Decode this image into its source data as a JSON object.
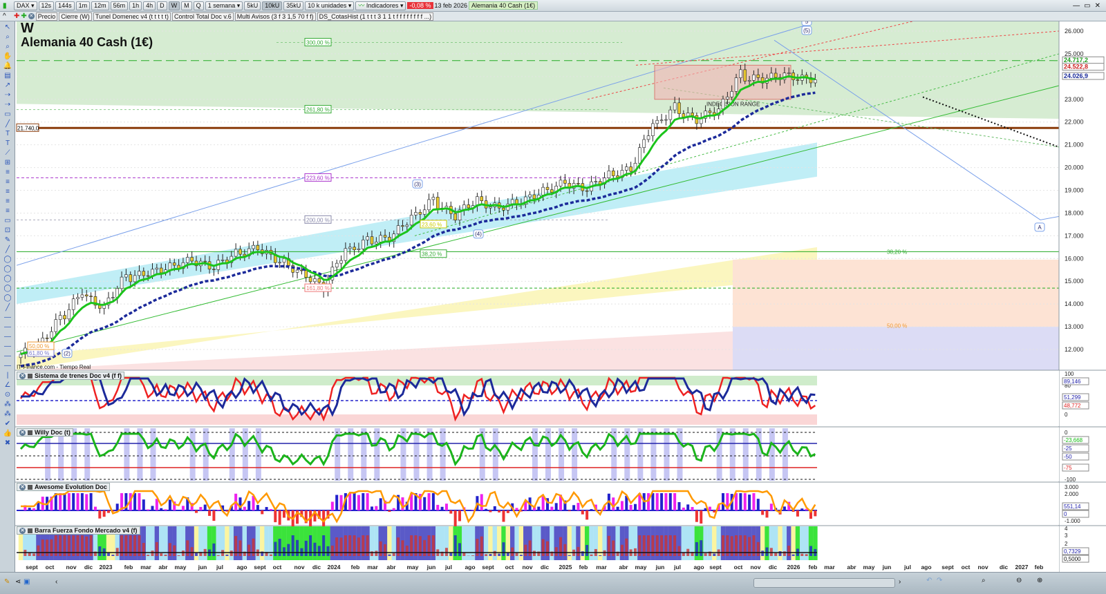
{
  "toolbar": {
    "symbol": "DAX",
    "timeframes": [
      "12s",
      "144s",
      "1m",
      "12m",
      "56m",
      "1h",
      "4h",
      "D",
      "W",
      "M",
      "Q"
    ],
    "active_timeframe": "W",
    "period": "1 semana",
    "volume_buttons": [
      "5kU",
      "10kU",
      "35kU"
    ],
    "active_volume": "10kU",
    "units": "10 k unidades",
    "indicators_label": "Indicadores",
    "change": "-0,08 %",
    "date": "13 feb 2026",
    "instrument": "Alemania 40 Cash (1€)"
  },
  "studies_bar": [
    "Precio",
    "Cierre (W)",
    "Tunel Domenec v4 (t t t t t)",
    "Control Total Doc v.6",
    "Multi Avisos (3 f 3 1,5 70 f f)",
    "DS_CotasHist (1 t t t 3 1 1 t f f f f f f f f ...)"
  ],
  "chart": {
    "period_letter": "W",
    "title": "Alemania 40 Cash (1€)",
    "source": "IT-Finance.com - Tiempo Real",
    "range_label": "INDECISION RANGE",
    "level_label": "21.740,0",
    "fib_labels": [
      {
        "t": "300,00 %",
        "p": 25500,
        "c": "#3a3"
      },
      {
        "t": "261,80 %",
        "p": 22550,
        "c": "#3a3"
      },
      {
        "t": "223,60 %",
        "p": 19550,
        "c": "#a3c"
      },
      {
        "t": "200,00 %",
        "p": 17700,
        "c": "#88a"
      },
      {
        "t": "161,80 %",
        "p": 14700,
        "c": "#e77"
      },
      {
        "t": "38,20 %",
        "p": 16200,
        "c": "#3a3"
      },
      {
        "t": "23,60 %",
        "p": 17500,
        "c": "#cc0"
      },
      {
        "t": "61,80 %",
        "p": 11850,
        "c": "#77c"
      },
      {
        "t": "50,00 %",
        "p": 12150,
        "c": "#e93"
      }
    ],
    "fib_right": [
      {
        "t": "38,20 %",
        "p": 16300
      },
      {
        "t": "50,00 %",
        "p": 13050
      }
    ],
    "waves": [
      "(2)",
      "(3)",
      "(4)",
      "(5)",
      "5",
      "A"
    ],
    "price_axis": [
      "26.000",
      "25.000",
      "23.000",
      "22.000",
      "21.000",
      "20.000",
      "19.000",
      "18.000",
      "17.000",
      "16.000",
      "15.000",
      "14.000",
      "13.000",
      "12.000"
    ],
    "price_tags": [
      {
        "t": "24.717,2",
        "c": "#1a9a1a"
      },
      {
        "t": "24.522,8",
        "c": "#c22"
      },
      {
        "t": "24.026,9",
        "c": "#1a2a9a"
      }
    ]
  },
  "panels": [
    {
      "title": "Sistema de trenes Doc v4 (f f)",
      "axis": [
        "100",
        "80",
        "20",
        "0"
      ],
      "tags": [
        {
          "t": "89,146",
          "c": "#22a"
        },
        {
          "t": "51,299",
          "c": "#22a"
        },
        {
          "t": "48,772",
          "c": "#d22"
        }
      ]
    },
    {
      "title": "Willy Doc (t)",
      "axis": [
        "0",
        "-50",
        "-100"
      ],
      "tags": [
        {
          "t": "-23,668",
          "c": "#1b1"
        },
        {
          "t": "-25",
          "c": "#22a"
        },
        {
          "t": "-50",
          "c": "#22a"
        },
        {
          "t": "-75",
          "c": "#d22"
        }
      ]
    },
    {
      "title": "Awesome Evolution Doc",
      "axis": [
        "3.000",
        "2.000",
        "-1.000"
      ],
      "tags": [
        {
          "t": "551,14",
          "c": "#22a"
        },
        {
          "t": "0",
          "c": "#22a"
        }
      ]
    },
    {
      "title": "Barra Fuerza Fondo Mercado v4 (f)",
      "axis": [
        "4",
        "3",
        "2"
      ],
      "tags": [
        {
          "t": "0,7329",
          "c": "#22a"
        },
        {
          "t": "0,5000",
          "c": "#111"
        }
      ]
    }
  ],
  "date_axis": [
    "sept",
    "oct",
    "nov",
    "dic",
    "2023",
    "feb",
    "mar",
    "abr",
    "may",
    "jun",
    "jul",
    "ago",
    "sept",
    "oct",
    "nov",
    "dic",
    "2024",
    "feb",
    "mar",
    "abr",
    "may",
    "jun",
    "jul",
    "ago",
    "sept",
    "oct",
    "nov",
    "dic",
    "2025",
    "feb",
    "mar",
    "abr",
    "may",
    "jun",
    "jul",
    "ago",
    "sept",
    "oct",
    "nov",
    "dic",
    "2026",
    "feb",
    "mar",
    "abr",
    "may",
    "jun",
    "jul",
    "ago",
    "sept",
    "oct",
    "nov",
    "dic",
    "2027",
    "feb"
  ],
  "chart_data": {
    "type": "candlestick",
    "title": "Alemania 40 Cash (1€)",
    "interval": "weekly",
    "start": "2022-09",
    "ylim": [
      11500,
      26500
    ],
    "monthly_closes": [
      12100,
      13250,
      14400,
      13900,
      15100,
      15350,
      15600,
      15900,
      15650,
      16150,
      16450,
      15950,
      15400,
      14800,
      16200,
      16750,
      16900,
      17700,
      18500,
      17950,
      18500,
      18250,
      18500,
      18900,
      19300,
      19100,
      19600,
      19900,
      21700,
      22550,
      22150,
      22500,
      23950,
      23900,
      24050,
      23900,
      23880,
      23950,
      23800,
      24500,
      24550,
      24700
    ]
  }
}
